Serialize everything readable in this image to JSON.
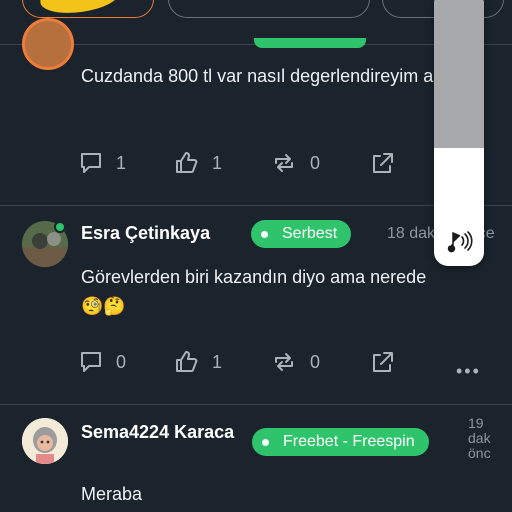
{
  "posts": [
    {
      "username": "",
      "badge": "",
      "time": "",
      "text": "Cuzdanda 800 tl var nasıl degerlendireyim acaba",
      "comments": "1",
      "likes": "1",
      "reposts": "0"
    },
    {
      "username": "Esra Çetinkaya",
      "badge": "Serbest",
      "time": "18 dakika önce",
      "text": "Görevlerden biri kazandın diyo ama nerede",
      "emoji": "🧐🤔",
      "comments": "0",
      "likes": "1",
      "reposts": "0",
      "more": "•••"
    },
    {
      "username": "Sema4224 Karaca",
      "badge": "Freebet - Freespin",
      "time_line1": "19",
      "time_line2": "dak",
      "time_line3": "önc",
      "text": "Meraba"
    }
  ],
  "colors": {
    "background": "#1b232c",
    "badge": "#2fc36b",
    "accent_orange": "#f07c3a",
    "highlight_yellow": "#f2c318"
  },
  "icons": [
    "comment-icon",
    "like-icon",
    "repost-icon",
    "share-icon",
    "sound-icon"
  ]
}
